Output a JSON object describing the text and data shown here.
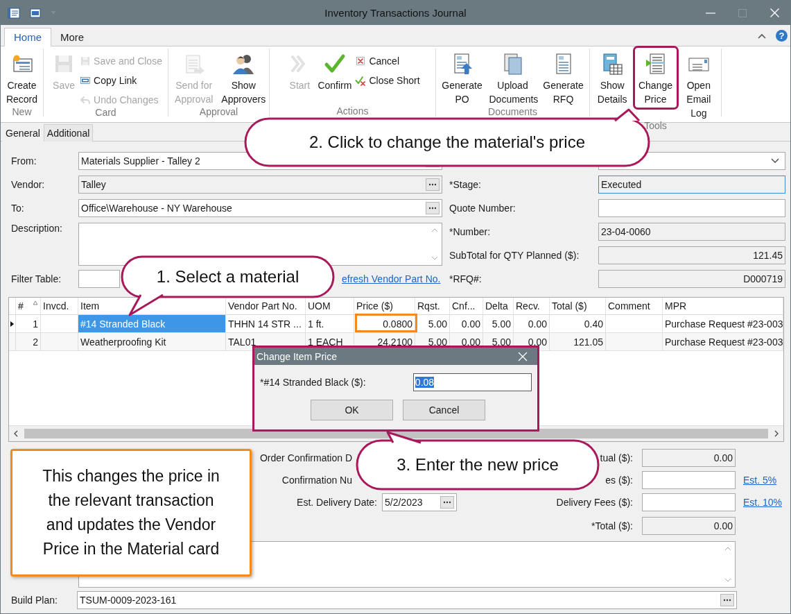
{
  "window": {
    "title": "Inventory Transactions Journal"
  },
  "ribbon_tabs": [
    {
      "label": "Home",
      "selected": true
    },
    {
      "label": "More",
      "selected": false
    }
  ],
  "help_button": "?",
  "ribbon_groups": [
    {
      "label": "New",
      "items": [
        {
          "kind": "large",
          "label": "Create Record",
          "disabled": false
        }
      ]
    },
    {
      "label": "Card",
      "items": [
        {
          "kind": "large",
          "label": "Save",
          "disabled": true
        },
        {
          "kind": "small",
          "label": "Save and Close",
          "disabled": true
        },
        {
          "kind": "small",
          "label": "Copy Link",
          "disabled": false
        },
        {
          "kind": "small",
          "label": "Undo Changes",
          "disabled": true
        }
      ]
    },
    {
      "label": "Approval",
      "items": [
        {
          "kind": "large",
          "label": "Send for Approval",
          "disabled": true
        },
        {
          "kind": "large",
          "label": "Show Approvers",
          "disabled": false
        }
      ]
    },
    {
      "label": "Actions",
      "items": [
        {
          "kind": "large",
          "label": "Start",
          "disabled": true
        },
        {
          "kind": "large",
          "label": "Confirm",
          "disabled": false
        },
        {
          "kind": "small",
          "label": "Cancel",
          "disabled": false
        },
        {
          "kind": "small",
          "label": "Close Short",
          "disabled": false
        }
      ]
    },
    {
      "label": "Documents",
      "items": [
        {
          "kind": "large",
          "label": "Generate PO",
          "disabled": false
        },
        {
          "kind": "large",
          "label": "Upload Documents",
          "disabled": false
        },
        {
          "kind": "large",
          "label": "Generate RFQ",
          "disabled": false
        }
      ]
    },
    {
      "label": "Tools",
      "items": [
        {
          "kind": "large",
          "label": "Show Details",
          "disabled": false
        },
        {
          "kind": "large",
          "label": "Change Price",
          "disabled": false
        },
        {
          "kind": "large",
          "label": "Open Email Log",
          "disabled": false
        }
      ]
    }
  ],
  "form_tabs": [
    {
      "label": "General",
      "selected": true
    },
    {
      "label": "Additional",
      "selected": false
    }
  ],
  "form_left": [
    {
      "label": "From:",
      "kind": "lookup",
      "value": "Materials Supplier - Talley 2",
      "readonly": false
    },
    {
      "label": "Vendor:",
      "kind": "lookup",
      "value": "Talley",
      "readonly": true
    },
    {
      "label": "To:",
      "kind": "lookup",
      "value": "Office\\Warehouse - NY Warehouse",
      "readonly": false
    },
    {
      "label": "Description:",
      "kind": "memo"
    },
    {
      "label": "Filter Table:",
      "kind": "filter",
      "link": "efresh Vendor Part No."
    }
  ],
  "form_right": [
    {
      "kind": "dropdown"
    },
    {
      "label": "*Stage:",
      "kind": "text",
      "value": "Executed",
      "readonly": true,
      "focused": true
    },
    {
      "label": "Quote Number:",
      "kind": "text",
      "readonly": false,
      "focused": false
    },
    {
      "label": "*Number:",
      "kind": "text",
      "value": "23-04-0060",
      "readonly": true,
      "focused": false
    },
    {
      "label": "SubTotal for QTY Planned ($):",
      "kind": "number",
      "value": "121.45",
      "readonly": true,
      "focused": false
    },
    {
      "label": "*RFQ#:",
      "kind": "number",
      "value": "D000719",
      "readonly": true,
      "focused": false
    }
  ],
  "table": {
    "columns": [
      {
        "label": "#",
        "sorted": true
      },
      {
        "label": "Invcd.",
        "sorted": false
      },
      {
        "label": "Item",
        "sorted": false
      },
      {
        "label": "Vendor Part No.",
        "sorted": false
      },
      {
        "label": "UOM",
        "sorted": false
      },
      {
        "label": "Price ($)",
        "sorted": false
      },
      {
        "label": "Rqst.",
        "sorted": false
      },
      {
        "label": "Cnf...",
        "sorted": false
      },
      {
        "label": "Delta",
        "sorted": false
      },
      {
        "label": "Recv.",
        "sorted": false
      },
      {
        "label": "Total ($)",
        "sorted": false
      },
      {
        "label": "Comment",
        "sorted": false
      },
      {
        "label": "MPR",
        "sorted": false
      }
    ],
    "rows": [
      {
        "selected": true,
        "cells": [
          "1",
          null,
          "#14 Stranded Black",
          "THHN 14 STR ...",
          "1 ft.",
          "0.0800",
          "5.00",
          "0.00",
          "5.00",
          "0.00",
          "0.40",
          null,
          "Purchase Request #23-003"
        ]
      },
      {
        "selected": false,
        "cells": [
          "2",
          null,
          "Weatherproofing Kit",
          "TAL01",
          "1 EACH",
          "24.2100",
          "5.00",
          "0.00",
          "5.00",
          "0.00",
          "121.05",
          null,
          "Purchase Request #23-003"
        ]
      }
    ]
  },
  "details_left": [
    {
      "label": "Order Confirmation D"
    },
    {
      "label": "Confirmation Nu"
    },
    {
      "label": "Est. Delivery Date:",
      "value": "5/2/2023"
    }
  ],
  "details_right": [
    {
      "label": "tual ($):",
      "value": "0.00",
      "readonly": true
    },
    {
      "label": "es ($):",
      "readonly": false,
      "link": "Est. 5%"
    },
    {
      "label": "Delivery Fees ($):",
      "readonly": false,
      "link": "Est. 10%"
    },
    {
      "label": "*Total ($):",
      "value": "0.00",
      "readonly": true
    }
  ],
  "build_plan": {
    "label": "Build Plan:",
    "value": "TSUM-0009-2023-161"
  },
  "dialog": {
    "title": "Change Item Price",
    "field_label": "*#14 Stranded Black ($):",
    "value": "0.08",
    "value_selected": true,
    "buttons": [
      "OK",
      "Cancel"
    ]
  },
  "callouts": [
    {
      "text": "2. Click to change the material's price"
    },
    {
      "text": "1. Select a material"
    },
    {
      "text": "3. Enter the new price"
    }
  ],
  "note": {
    "text": "This changes the price in the relevant transaction and updates the Vendor Price in the Material card"
  }
}
